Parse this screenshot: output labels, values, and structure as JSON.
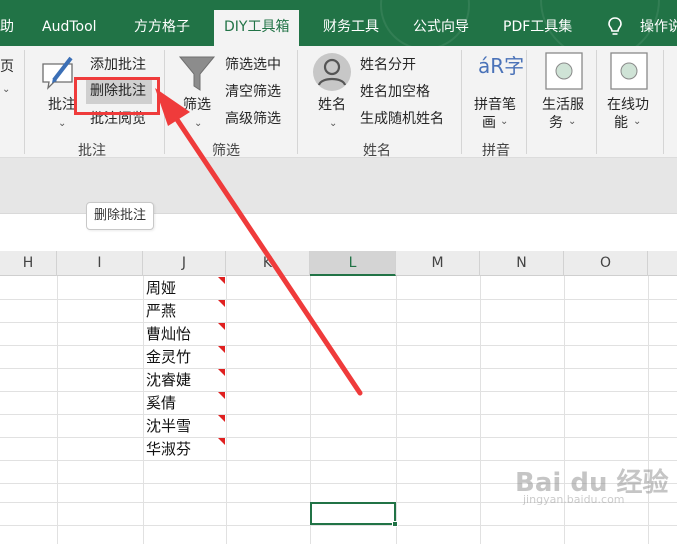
{
  "tabs": [
    {
      "label": "助"
    },
    {
      "label": "AudTool"
    },
    {
      "label": "方方格子"
    },
    {
      "label": "DIY工具箱"
    },
    {
      "label": "财务工具"
    },
    {
      "label": "公式向导"
    },
    {
      "label": "PDF工具集"
    }
  ],
  "help_label": "操作说",
  "ribbon": {
    "left_edge": {
      "top": "页",
      "caret": "⌄"
    },
    "comment_group": {
      "big_button": "批注",
      "add": "添加批注",
      "delete": "删除批注",
      "browse": "批注阅览",
      "label": "批注"
    },
    "filter_group": {
      "big_button": "筛选",
      "filter_selected": "筛选选中",
      "clear_filter": "清空筛选",
      "advanced_filter": "高级筛选",
      "label": "筛选"
    },
    "name_group": {
      "big_button": "姓名",
      "split": "姓名分开",
      "add_spaces": "姓名加空格",
      "random": "生成随机姓名",
      "label": "姓名"
    },
    "pinyin_group": {
      "big_button_line1": "拼音笔",
      "big_button_line2": "画",
      "label": "拼音",
      "icon_text": "áR字"
    },
    "life_service": {
      "line1": "生活服",
      "line2": "务"
    },
    "online_func": {
      "line1": "在线功",
      "line2": "能"
    }
  },
  "tooltip": "删除批注",
  "columns": [
    "H",
    "I",
    "J",
    "K",
    "L",
    "M",
    "N",
    "O"
  ],
  "selected_column": "L",
  "cells_J": [
    "周娅",
    "严燕",
    "曹灿怡",
    "金灵竹",
    "沈睿婕",
    "奚倩",
    "沈半雪",
    "华淑芬"
  ],
  "watermark": {
    "main": "Bai du 经验",
    "sub": "jingyan.baidu.com"
  },
  "colors": {
    "excel_green": "#217346",
    "annotation_red": "#ef3b3b",
    "comment_marker": "#e02020"
  }
}
